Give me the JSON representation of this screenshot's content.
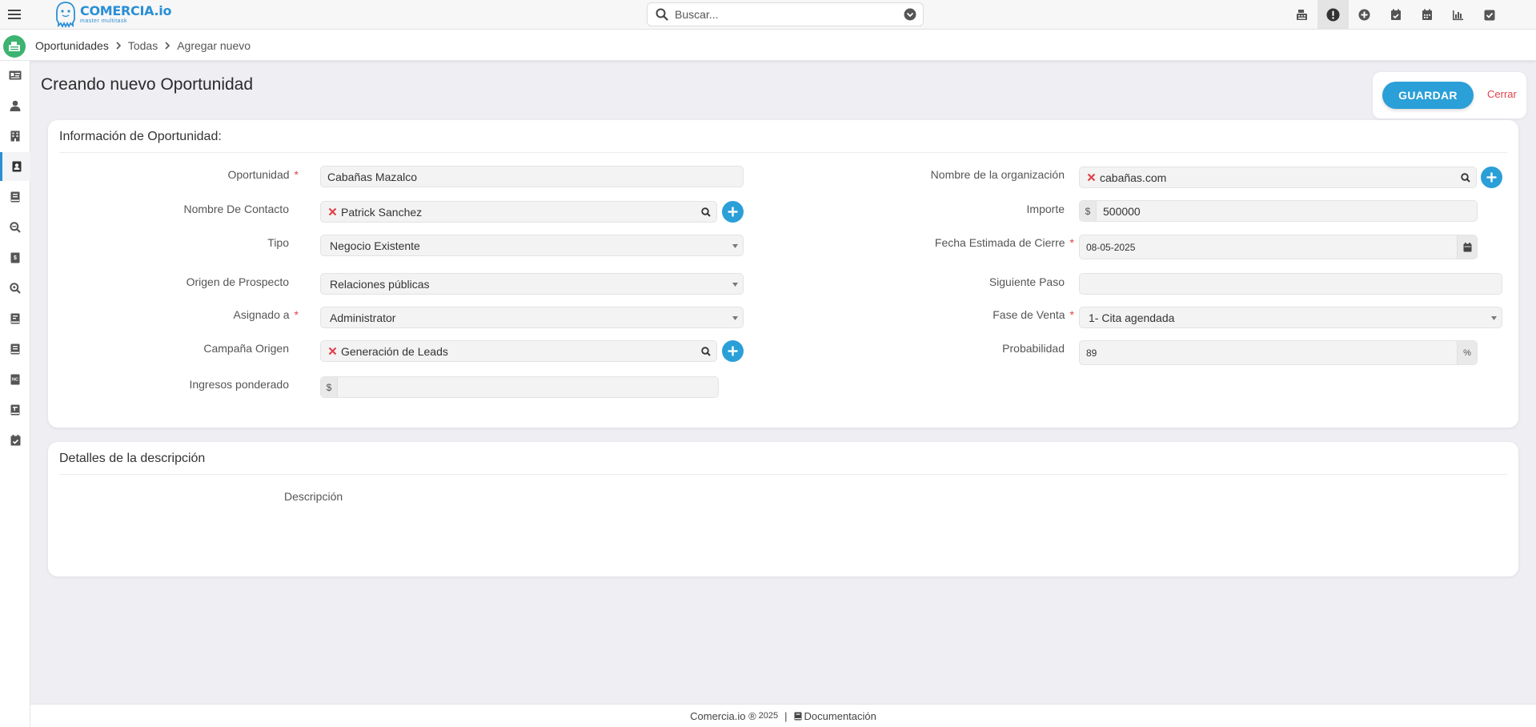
{
  "app": {
    "logo_name": "COMERCIA.io",
    "logo_tagline": "master multitask",
    "brand_color": "#2a8fd6",
    "accent_color": "#2a9fd8",
    "danger_color": "#e0424b"
  },
  "search": {
    "placeholder": "Buscar..."
  },
  "topbar_icons": [
    "cash-register-icon",
    "alert-circle-icon",
    "plus-circle-icon",
    "calendar-check-icon",
    "calendar-icon",
    "bar-chart-icon",
    "check-square-icon"
  ],
  "breadcrumb": {
    "module": "Oportunidades",
    "list": "Todas",
    "current": "Agregar nuevo"
  },
  "sidebar_icons": [
    "id-card-icon",
    "user-icon",
    "building-icon",
    "contact-book-icon",
    "book-icon",
    "search-icon",
    "dollar-doc-icon",
    "search-icon",
    "book-icon",
    "book-icon",
    "nc-doc-icon",
    "book-icon",
    "calendar-check-icon"
  ],
  "page": {
    "title": "Creando nuevo Oportunidad"
  },
  "actions": {
    "save_label": "GUARDAR",
    "close_label": "Cerrar"
  },
  "panel1": {
    "title": "Información de Oportunidad:",
    "oportunidad": {
      "label": "Oportunidad",
      "value": "Cabañas Mazalco"
    },
    "contacto": {
      "label": "Nombre De Contacto",
      "value": "Patrick Sanchez"
    },
    "tipo": {
      "label": "Tipo",
      "value": "Negocio Existente"
    },
    "origen": {
      "label": "Origen de Prospecto",
      "value": "Relaciones públicas"
    },
    "asignado": {
      "label": "Asignado a",
      "value": "Administrator"
    },
    "campana": {
      "label": "Campaña Origen",
      "value": "Generación de Leads"
    },
    "ingresos": {
      "label": "Ingresos ponderado",
      "prefix": "$",
      "value": ""
    },
    "organizacion": {
      "label": "Nombre de la organización",
      "value": "cabañas.com"
    },
    "importe": {
      "label": "Importe",
      "prefix": "$",
      "value": "500000"
    },
    "fecha": {
      "label": "Fecha Estimada de Cierre",
      "value": "08-05-2025"
    },
    "siguiente": {
      "label": "Siguiente Paso",
      "value": ""
    },
    "fase": {
      "label": "Fase de Venta",
      "value": "1- Cita agendada"
    },
    "probabilidad": {
      "label": "Probabilidad",
      "value": "89",
      "suffix": "%"
    },
    "required_mark": "*"
  },
  "panel2": {
    "title": "Detalles de la descripción",
    "descripcion_label": "Descripción"
  },
  "footer": {
    "brand": "Comercia.io ®",
    "year": "2025",
    "separator": "|",
    "doc_label": "Documentación"
  }
}
